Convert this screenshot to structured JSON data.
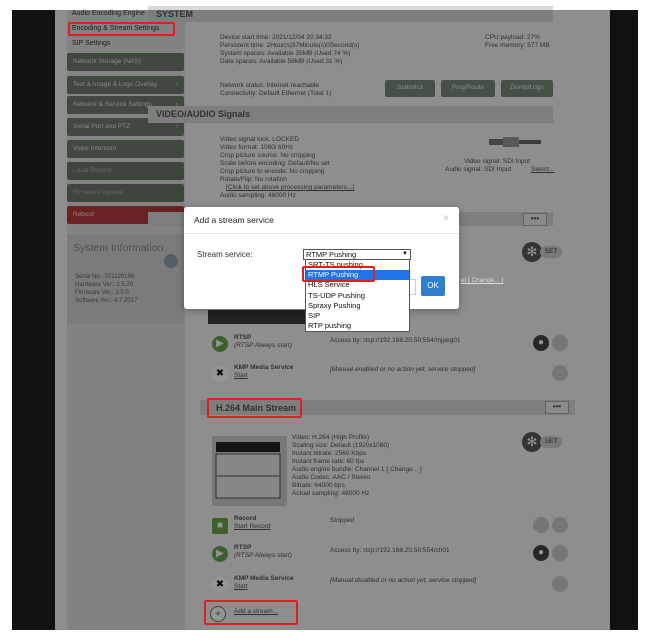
{
  "sidebar": {
    "links": [
      "Audio Encoding Engine",
      "Encoding & Stream Settings",
      "SIP Settings"
    ],
    "buttons": [
      {
        "label": "Network Storage (NAS)",
        "arrow": ""
      },
      {
        "label": "Text & Image & Logo Overlay",
        "arrow": "›"
      },
      {
        "label": "Network & Service Settings",
        "arrow": "›"
      },
      {
        "label": "Serial Port and PTZ",
        "arrow": "›"
      },
      {
        "label": "Voice Intercom",
        "arrow": ""
      },
      {
        "label": "Local Record",
        "arrow": ""
      },
      {
        "label": "Firmware Update",
        "arrow": ""
      },
      {
        "label": "Reboot",
        "arrow": ""
      }
    ],
    "system_info": {
      "title": "System Information",
      "lines": [
        "Serial No.: 201120196",
        "Hardware Ver.: 1.5.20",
        "Firmware Ver.: 2.5.0",
        "Software Ver.: 4.7.2017"
      ]
    }
  },
  "system": {
    "title": "SYSTEM",
    "left": [
      "Device start time: 2021/12/04 20:34:32",
      "Persistent time: 2Hour(s)37Minute(s)0Second(s)",
      "System spaces: Available 35MB (Used 74 %)",
      "Data spaces: Available 58MB (Used 31 %)"
    ],
    "right": [
      "CPU payload: 27%",
      "Free memory: 577 MB"
    ],
    "network": [
      "Network status: Internet reachable",
      "Connectivity: Default Ethernet (Total 1)"
    ],
    "buttons": [
      "Statistics",
      "Ping/Route",
      "Dump/Logs"
    ]
  },
  "video_audio": {
    "title": "VIDEO/AUDIO Signals",
    "lines": [
      "Video signal lock: LOCKED",
      "Video format: 1080i 60Hz",
      "Crop picture source: No cropping",
      "Scale before encoding: Default/No set",
      "Crop picture to encode: No cropping",
      "Rotate/Flip: No rotation",
      "[Click to set above processing parameters...]",
      "Audio sampling: 48000 Hz"
    ],
    "signal": [
      "Video signal: SDI Input",
      "Audio signal: SDI Input",
      "Select..."
    ]
  },
  "set_label": "SET",
  "more_label": "•••",
  "stream1": {
    "rtsp_title": "RTSP",
    "rtsp_sub": "(RTSP Always start)",
    "rtsp_access": "Access by: rtsp://192.168.20.50:554/mjpeg01",
    "kmp_title": "KMP Media Service",
    "kmp_start": "Start",
    "kmp_msg": "[Manual enabled or no action yet, service stopped]"
  },
  "main_stream": {
    "title": "H.264 Main Stream",
    "info": [
      "Video: H.264 (High Profile)",
      "Scaling size: Default (1920x1080)",
      "Instant bitrate: 2560 Kbps",
      "Instant frame rate: 60 fps",
      "Audio engine bundle: Channel 1 [ Change... ]",
      "Audio Codec: AAC / Stereo",
      "Bitrate: 64000 bps",
      "Actual sampling: 48000 Hz"
    ],
    "record_title": "Record",
    "record_sub": "Start Record",
    "record_status": "Stopped",
    "rtsp_title": "RTSP",
    "rtsp_sub": "(RTSP Always start)",
    "rtsp_access": "Access by: rtsp://192.168.20.50:554/ch01",
    "kmp_title": "KMP Media Service",
    "kmp_start": "Start",
    "kmp_msg": "[Manual disabled or no action yet, service stopped]",
    "add_stream": "Add a stream..."
  },
  "modal": {
    "title": "Add a stream service",
    "close": "×",
    "field_label": "Stream service:",
    "selected": "RTMP Pushing",
    "options": [
      "SRT-TS pushing",
      "RTMP Pushing",
      "HLS Service",
      "TS-UDP Pushing",
      "Spraxy Pushing",
      "SIP",
      "RTP pushing"
    ],
    "highlighted_index": 1,
    "partial_link": "el [ Change... ]",
    "ok": "OK"
  },
  "colors": {
    "highlight": "#e02020",
    "selected_option": "#1e74e8",
    "ok_button": "#2f7fcf"
  }
}
